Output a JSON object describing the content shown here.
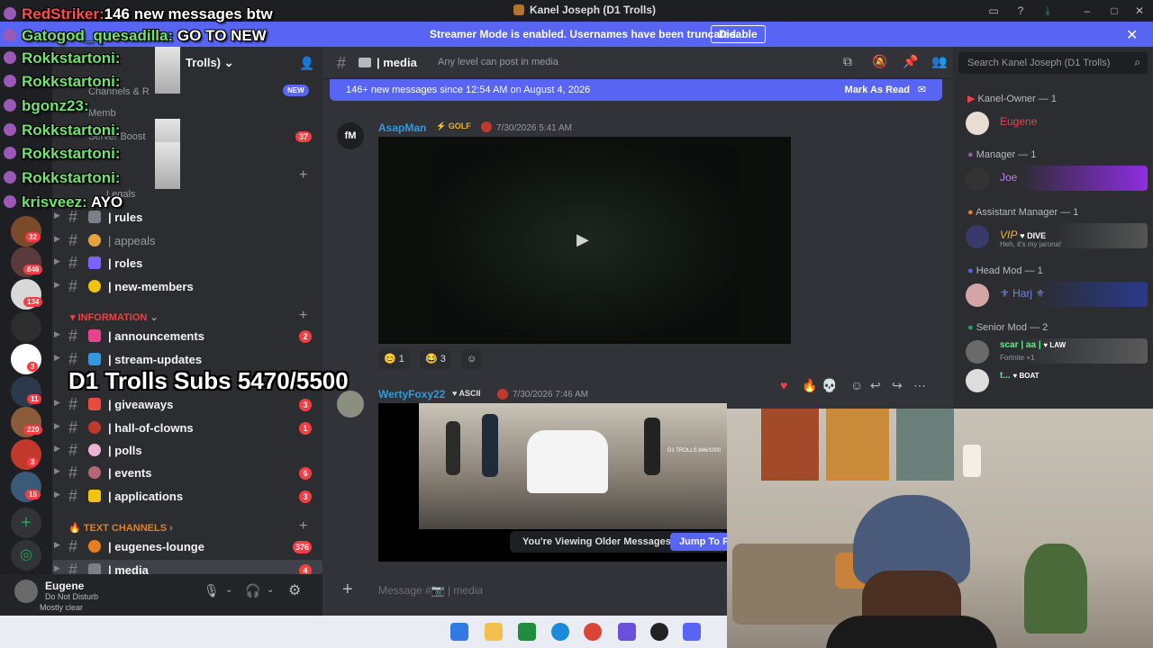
{
  "window": {
    "title": "Kanel Joseph (D1 Trolls)"
  },
  "banner": {
    "message": "Streamer Mode is enabled. Usernames have been truncated.",
    "disable_label": "Disable"
  },
  "server": {
    "name_partial": "Kanel Joseph (D1 Trolls)",
    "visible_name_tail": "Trolls)",
    "new_badge": "NEW",
    "boost_count": "37",
    "partial_items": [
      "Channels & R",
      "Memb",
      "Server Boost",
      "Legals"
    ]
  },
  "rail": {
    "badges": [
      "32",
      "846",
      "134",
      "3",
      "11",
      "220",
      "3",
      "15"
    ]
  },
  "channels": [
    {
      "name": "| rules",
      "count": ""
    },
    {
      "name": "| appeals",
      "count": "",
      "dim": true
    },
    {
      "name": "| roles",
      "count": ""
    },
    {
      "name": "| new-members",
      "count": ""
    }
  ],
  "categories": {
    "information": "INFORMATION",
    "text_channels": "TEXT CHANNELS"
  },
  "info_channels": [
    {
      "name": "| announcements",
      "count": "2"
    },
    {
      "name": "| stream-updates",
      "count": ""
    },
    {
      "name": "| giveaways",
      "count": "3"
    },
    {
      "name": "| hall-of-clowns",
      "count": "1"
    },
    {
      "name": "| polls",
      "count": ""
    },
    {
      "name": "| events",
      "count": "6"
    },
    {
      "name": "| applications",
      "count": "3"
    }
  ],
  "text_channels": [
    {
      "name": "| eugenes-lounge",
      "count": "376"
    },
    {
      "name": "| media",
      "count": "4"
    }
  ],
  "user_panel": {
    "name": "Eugene",
    "status": "Do Not Disturb",
    "weather": "Mostly clear"
  },
  "header": {
    "channel": "| media",
    "topic": "Any level can post in media",
    "search_placeholder": "Search Kanel Joseph (D1 Trolls)"
  },
  "new_messages": {
    "text": "146+ new messages since 12:54 AM on August 4, 2026",
    "mark_label": "Mark As Read"
  },
  "messages": [
    {
      "author": "AsapMan",
      "tag": "GOLF",
      "time": "7/30/2026 5:41 AM",
      "reactions": [
        {
          "emoji": "😊",
          "count": "1"
        },
        {
          "emoji": "😂",
          "count": "3"
        }
      ]
    },
    {
      "author": "WertyFoxy22",
      "tag": "ASCII",
      "time": "7/30/2026 7:46 AM",
      "video_watermark": "D1 TROLLS 846/1000"
    }
  ],
  "older_bar": {
    "text": "You're Viewing Older Messages",
    "jump_label": "Jump To P"
  },
  "composer": {
    "placeholder": "Message #📷 | media"
  },
  "members": {
    "roles": [
      {
        "label": "Kanel-Owner — 1",
        "color": "#f23f43"
      },
      {
        "label": "Manager — 1",
        "color": "#9b59b6"
      },
      {
        "label": "Assistant Manager — 1",
        "color": "#e67e22"
      },
      {
        "label": "Head Mod — 1",
        "color": "#5865f2"
      },
      {
        "label": "Senior Mod — 2",
        "color": "#23a559"
      }
    ],
    "people": [
      {
        "name": "Eugene",
        "status": "",
        "color": "#f23f43"
      },
      {
        "name": "Joe",
        "status": "",
        "color": "#c27cff"
      },
      {
        "name": "VIP",
        "tag": "DIVE",
        "status": "Heh, it's my jarona!",
        "color": "#f0b232"
      },
      {
        "name": "Harj",
        "status": "",
        "color": "#7289da"
      },
      {
        "name": "scar | aa |",
        "tag": "LAW",
        "status": "Fortnite +1",
        "color": "#57f287"
      },
      {
        "name": "t...",
        "tag": "BOAT",
        "status": "",
        "color": "#57f287"
      }
    ]
  },
  "chat_overlay": [
    {
      "user": "RedStriker:",
      "text": "146 new messages btw",
      "color": "#ff4d4d"
    },
    {
      "user": "Gatogod_quesadilla:",
      "text": "GO TO NEW",
      "color": "#6fe36f"
    },
    {
      "user": "Rokkstartoni:",
      "text": "",
      "color": "#6fe36f"
    },
    {
      "user": "Rokkstartoni:",
      "text": "",
      "color": "#6fe36f"
    },
    {
      "user": "bgonz23:",
      "text": "",
      "color": "#6fe36f"
    },
    {
      "user": "Rokkstartoni:",
      "text": "",
      "color": "#6fe36f"
    },
    {
      "user": "Rokkstartoni:",
      "text": "",
      "color": "#6fe36f"
    },
    {
      "user": "Rokkstartoni:",
      "text": "",
      "color": "#6fe36f"
    },
    {
      "user": "krisveez:",
      "text": "AYO",
      "color": "#6fe36f"
    }
  ],
  "subs_overlay": "D1 Trolls Subs 5470/5500",
  "colors": {
    "blurple": "#5865f2",
    "red": "#f23f43",
    "bg": "#313338"
  }
}
